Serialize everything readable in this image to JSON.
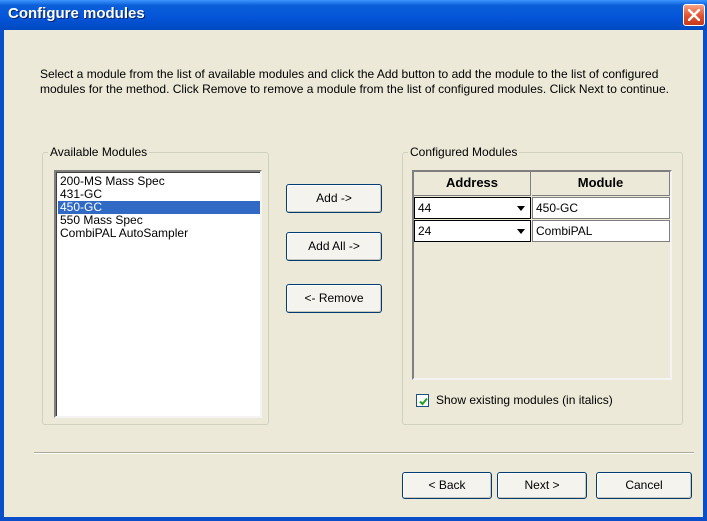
{
  "window": {
    "title": "Configure modules",
    "close_icon": "close-x-icon",
    "accent_color": "#0454d8"
  },
  "instructions": "Select a module from the list of available modules and click the Add button to add the module to the list of configured modules for the method. Click Remove to remove a module from the list of configured modules. Click Next to continue.",
  "available": {
    "legend": "Available Modules",
    "items": [
      {
        "label": "200-MS Mass Spec",
        "selected": false
      },
      {
        "label": "431-GC",
        "selected": false
      },
      {
        "label": "450-GC",
        "selected": true
      },
      {
        "label": "550 Mass Spec",
        "selected": false
      },
      {
        "label": "CombiPAL AutoSampler",
        "selected": false
      }
    ]
  },
  "buttons": {
    "add": "Add ->",
    "add_all": "Add All ->",
    "remove": "<- Remove"
  },
  "configured": {
    "legend": "Configured Modules",
    "columns": {
      "address": "Address",
      "module": "Module"
    },
    "rows": [
      {
        "address": "44",
        "module": "450-GC"
      },
      {
        "address": "24",
        "module": "CombiPAL"
      }
    ],
    "show_existing": {
      "label": "Show existing modules (in italics)",
      "checked": true
    }
  },
  "footer": {
    "back": "< Back",
    "next": "Next >",
    "cancel": "Cancel"
  }
}
